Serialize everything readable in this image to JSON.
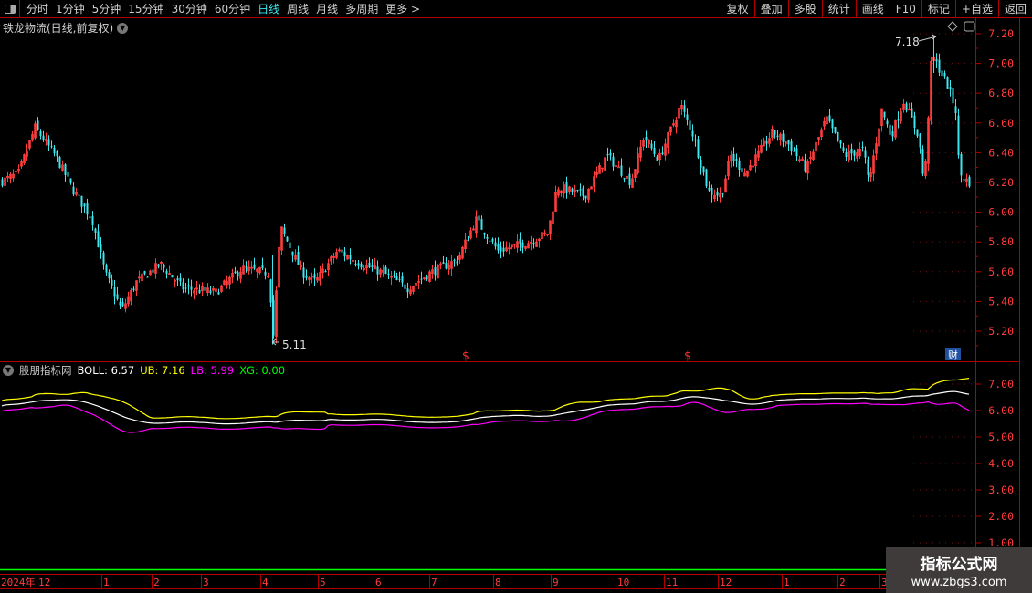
{
  "toolbar": {
    "periods": [
      "分时",
      "1分钟",
      "5分钟",
      "15分钟",
      "30分钟",
      "60分钟",
      "日线",
      "周线",
      "月线",
      "多周期",
      "更多 >"
    ],
    "active_period": "日线",
    "buttons": [
      "复权",
      "叠加",
      "多股",
      "统计",
      "画线",
      "F10",
      "标记",
      "+自选",
      "返回"
    ]
  },
  "stock": {
    "title": "铁龙物流(日线,前复权)"
  },
  "indicator": {
    "name": "股朋指标网",
    "boll_label": "BOLL: 6.57",
    "ub_label": "UB: 7.16",
    "lb_label": "LB: 5.99",
    "xg_label": "XG: 0.00"
  },
  "colors": {
    "up": "#ff3c3c",
    "down": "#3ee6ee",
    "mid": "#ffffff",
    "ub": "#ffff00",
    "lb": "#ff00ff",
    "xg": "#00ff00",
    "axis": "#b00000"
  },
  "annotations": {
    "high_label": "7.18",
    "low_label": "5.11",
    "dividend_marker": "$",
    "finance_marker": "财"
  },
  "chart_data": {
    "type": "candlestick",
    "price_axis_ticks": [
      "7.20",
      "7.00",
      "6.80",
      "6.60",
      "6.40",
      "6.20",
      "6.00",
      "5.80",
      "5.60",
      "5.40",
      "5.20"
    ],
    "indicator_axis_ticks": [
      "7.00",
      "6.00",
      "5.00",
      "4.00",
      "3.00",
      "2.00",
      "1.00"
    ],
    "time_axis_labels": [
      "2024年",
      "12",
      "1",
      "2",
      "3",
      "4",
      "5",
      "6",
      "7",
      "8",
      "9",
      "10",
      "11",
      "12",
      "1",
      "2",
      "3"
    ],
    "price_path": [
      [
        "2023-11-10",
        6.2
      ],
      [
        "2023-11-20",
        6.26
      ],
      [
        "2023-11-29",
        6.57
      ],
      [
        "2023-12-10",
        6.38
      ],
      [
        "2023-12-20",
        6.14
      ],
      [
        "2023-12-30",
        5.95
      ],
      [
        "2024-01-06",
        5.59
      ],
      [
        "2024-01-15",
        5.34
      ],
      [
        "2024-01-23",
        5.53
      ],
      [
        "2024-02-05",
        5.65
      ],
      [
        "2024-02-17",
        5.49
      ],
      [
        "2024-03-06",
        5.46
      ],
      [
        "2024-03-20",
        5.62
      ],
      [
        "2024-04-04",
        5.59
      ],
      [
        "2024-04-06",
        5.13
      ],
      [
        "2024-04-10",
        5.9
      ],
      [
        "2024-04-22",
        5.59
      ],
      [
        "2024-04-29",
        5.53
      ],
      [
        "2024-05-11",
        5.74
      ],
      [
        "2024-05-24",
        5.65
      ],
      [
        "2024-06-05",
        5.59
      ],
      [
        "2024-06-18",
        5.49
      ],
      [
        "2024-06-30",
        5.59
      ],
      [
        "2024-07-15",
        5.68
      ],
      [
        "2024-07-25",
        5.95
      ],
      [
        "2024-08-06",
        5.74
      ],
      [
        "2024-08-23",
        5.8
      ],
      [
        "2024-09-02",
        5.86
      ],
      [
        "2024-09-07",
        6.17
      ],
      [
        "2024-09-22",
        6.11
      ],
      [
        "2024-10-04",
        6.38
      ],
      [
        "2024-10-17",
        6.2
      ],
      [
        "2024-10-24",
        6.51
      ],
      [
        "2024-11-01",
        6.35
      ],
      [
        "2024-11-13",
        6.72
      ],
      [
        "2024-11-20",
        6.51
      ],
      [
        "2024-11-28",
        6.14
      ],
      [
        "2024-12-05",
        6.11
      ],
      [
        "2024-12-10",
        6.38
      ],
      [
        "2024-12-18",
        6.26
      ],
      [
        "2025-01-02",
        6.54
      ],
      [
        "2025-01-11",
        6.45
      ],
      [
        "2025-01-20",
        6.29
      ],
      [
        "2025-01-31",
        6.63
      ],
      [
        "2025-02-10",
        6.38
      ],
      [
        "2025-02-20",
        6.42
      ],
      [
        "2025-02-23",
        6.2
      ],
      [
        "2025-03-02",
        6.69
      ],
      [
        "2025-03-07",
        6.51
      ],
      [
        "2025-03-14",
        6.75
      ],
      [
        "2025-03-22",
        6.51
      ],
      [
        "2025-03-25",
        6.17
      ],
      [
        "2025-03-29",
        7.06
      ],
      [
        "2025-04-06",
        6.87
      ],
      [
        "2025-04-11",
        6.69
      ],
      [
        "2025-04-13",
        6.26
      ],
      [
        "2025-04-18",
        6.2
      ]
    ],
    "high": {
      "value": 7.18
    },
    "low": {
      "value": 5.11
    },
    "xg": 0.0
  },
  "watermark": {
    "line1": "指标公式网",
    "line2": "www.zbgs3.com"
  }
}
